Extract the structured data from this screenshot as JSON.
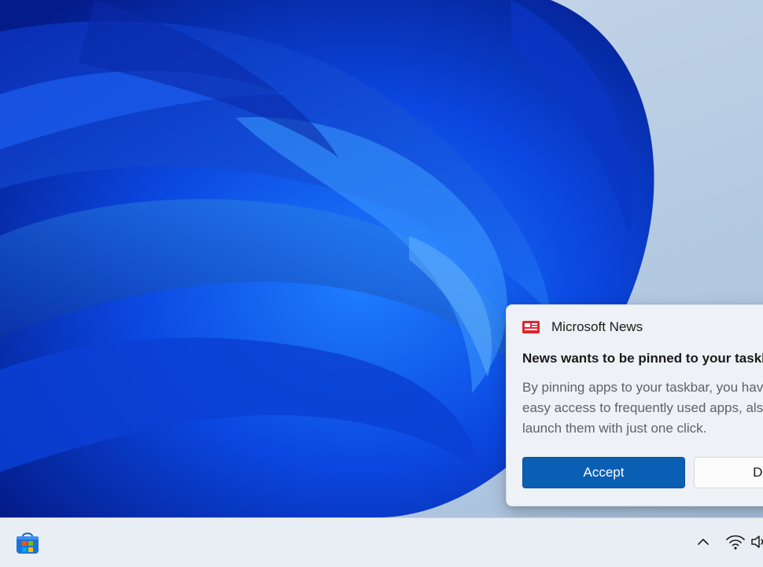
{
  "notification": {
    "app_name": "Microsoft News",
    "title": "News wants to be pinned to your taskbar",
    "body_lines": [
      "By pinning apps to your taskbar, you have",
      "easy access to frequently used apps, also",
      "launch them with just one click."
    ],
    "accept_label": "Accept",
    "decline_label": "Decline"
  },
  "taskbar": {
    "pinned": [
      {
        "icon": "microsoft-store-icon"
      }
    ],
    "tray": [
      {
        "icon": "chevron-up-icon"
      },
      {
        "icon": "wifi-icon"
      },
      {
        "icon": "volume-icon"
      }
    ]
  },
  "colors": {
    "accent": "#0a5fb4",
    "news_brand": "#e0262f",
    "wallpaper_blue": "#0a3bd1"
  }
}
